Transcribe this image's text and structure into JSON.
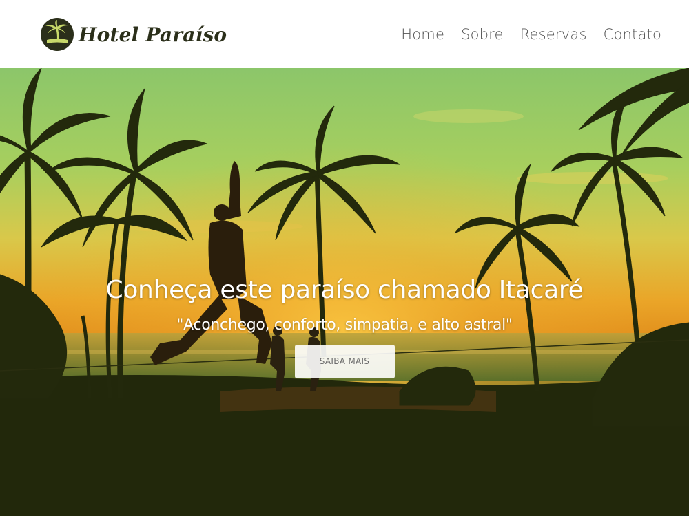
{
  "header": {
    "brand_name": "Hotel Paraíso",
    "logo_icon": "palm-tree-icon",
    "nav": [
      {
        "label": "Home"
      },
      {
        "label": "Sobre"
      },
      {
        "label": "Reservas"
      },
      {
        "label": "Contato"
      }
    ]
  },
  "hero": {
    "title": "Conheça este paraíso chamado Itacaré",
    "subtitle": "\"Aconchego, conforto, simpatia, e alto astral\"",
    "button_label": "SAIBA MAIS",
    "background_image": "sunset-beach-palm-trees-photo"
  },
  "colors": {
    "brand_text": "#2b2f1a",
    "nav_text": "#555555",
    "hero_bottom": "#1e2408",
    "sky_green": "#9fcf6a",
    "sunset_orange": "#e8a020"
  }
}
